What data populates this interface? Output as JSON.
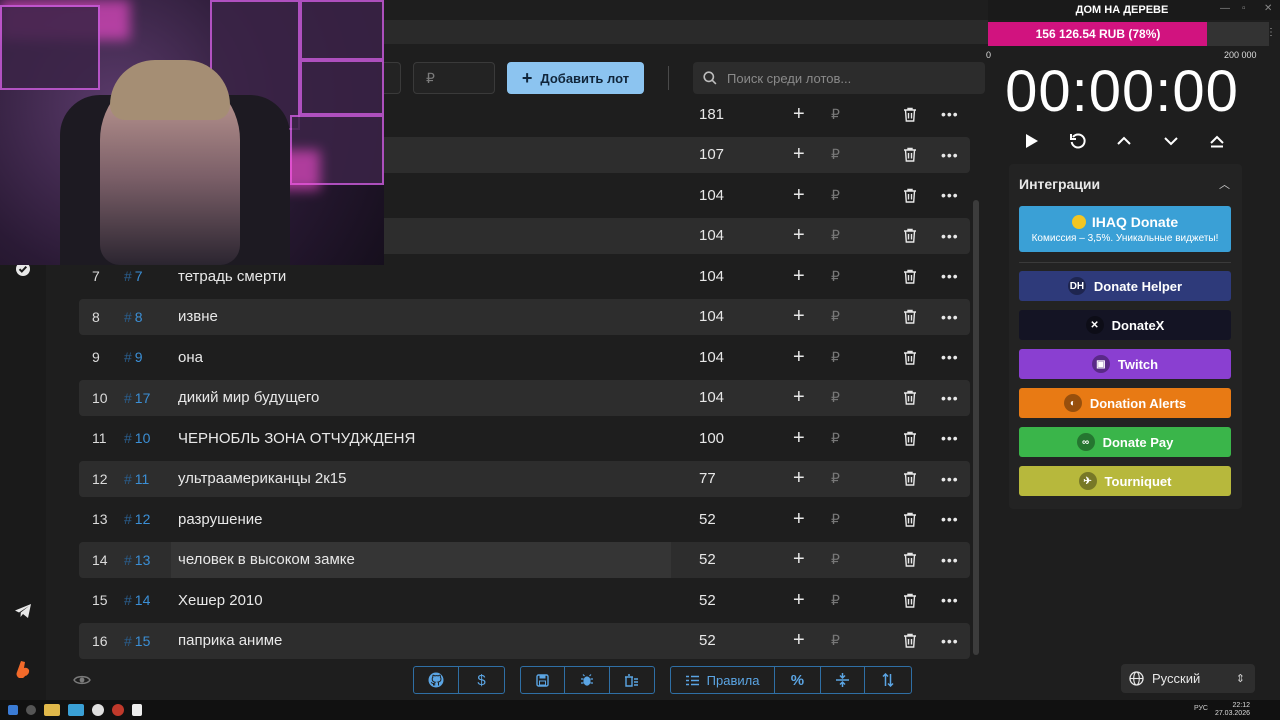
{
  "header": {
    "price_placeholder": "₽",
    "add_lot_label": "Добавить лот",
    "search_placeholder": "Поиск среди лотов..."
  },
  "lots": [
    {
      "num": "",
      "id": "",
      "name": "",
      "amount": "181"
    },
    {
      "num": "",
      "id": "",
      "name": "",
      "amount": "107"
    },
    {
      "num": "",
      "id": "",
      "name": "",
      "amount": "104"
    },
    {
      "num": "",
      "id": "",
      "name": "",
      "amount": "104"
    },
    {
      "num": "7",
      "id": "7",
      "name": "тетрадь смерти",
      "amount": "104"
    },
    {
      "num": "8",
      "id": "8",
      "name": "извне",
      "amount": "104"
    },
    {
      "num": "9",
      "id": "9",
      "name": "она",
      "amount": "104"
    },
    {
      "num": "10",
      "id": "17",
      "name": "дикий мир будущего",
      "amount": "104"
    },
    {
      "num": "11",
      "id": "10",
      "name": "ЧЕРНОБЛЬ ЗОНА ОТЧУДЖДЕНЯ",
      "amount": "100"
    },
    {
      "num": "12",
      "id": "11",
      "name": "ультраамериканцы 2к15",
      "amount": "77"
    },
    {
      "num": "13",
      "id": "12",
      "name": "разрушение",
      "amount": "52"
    },
    {
      "num": "14",
      "id": "13",
      "name": "человек в высоком замке",
      "amount": "52"
    },
    {
      "num": "15",
      "id": "14",
      "name": "Хешер 2010",
      "amount": "52"
    },
    {
      "num": "16",
      "id": "15",
      "name": "паприка аниме",
      "amount": "52"
    }
  ],
  "row_icons": {
    "plus": "+",
    "rub": "₽",
    "more": "•••"
  },
  "toolbar": {
    "rules_label": "Правила",
    "icons": [
      "github-icon",
      "dollar-icon",
      "save-icon",
      "bug-icon",
      "clear-icon",
      "list-icon",
      "percent-icon",
      "split-icon",
      "sort-icon"
    ]
  },
  "stream": {
    "title": "ДОМ НА ДЕРЕВЕ",
    "progress_text": "156 126.54 RUB (78%)",
    "progress_fraction": 0.78,
    "progress_min": "0",
    "progress_max": "200 000"
  },
  "timer": {
    "display": "00:00:00"
  },
  "integrations": {
    "title": "Интеграции",
    "ihaq": {
      "label": "IHAQ Donate",
      "subtitle": "Комиссия – 3,5%. Уникальные виджеты!"
    },
    "items": [
      {
        "label": "Donate Helper",
        "color": "#2e3a7a",
        "icon": "DH"
      },
      {
        "label": "DonateX",
        "color": "#141424",
        "icon": "✕"
      },
      {
        "label": "Twitch",
        "color": "#8a3fd1",
        "icon": "▣"
      },
      {
        "label": "Donation Alerts",
        "color": "#e87a14",
        "icon": "◐"
      },
      {
        "label": "Donate Pay",
        "color": "#3ab54a",
        "icon": "∞"
      },
      {
        "label": "Tourniquet",
        "color": "#b7b83c",
        "icon": "✈"
      }
    ]
  },
  "language": {
    "label": "Русский"
  },
  "taskbar": {
    "tray": "РУС",
    "time": "22:12",
    "date": "27.03.2026"
  },
  "colors": {
    "accent": "#8cc4f0",
    "progress": "#d1137f",
    "id_link": "#3b8fd6"
  }
}
